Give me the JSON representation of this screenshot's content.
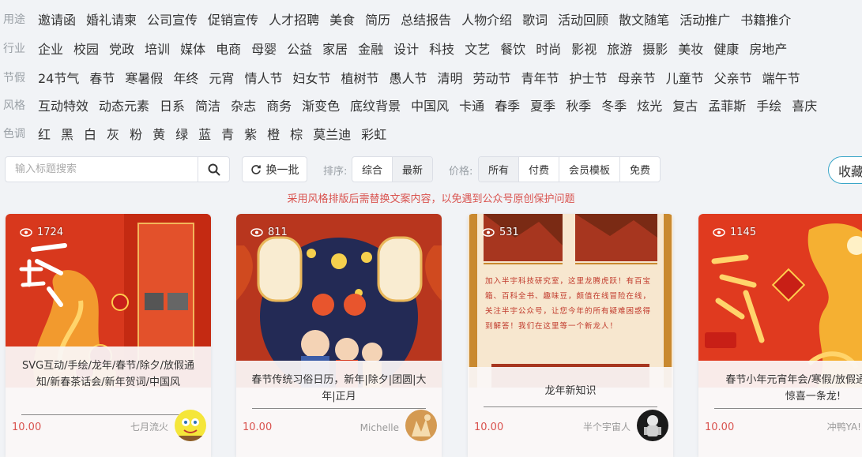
{
  "filters": [
    {
      "label": "用途",
      "items": [
        "邀请函",
        "婚礼请柬",
        "公司宣传",
        "促销宣传",
        "人才招聘",
        "美食",
        "简历",
        "总结报告",
        "人物介绍",
        "歌词",
        "活动回顾",
        "散文随笔",
        "活动推广",
        "书籍推介"
      ]
    },
    {
      "label": "行业",
      "items": [
        "企业",
        "校园",
        "党政",
        "培训",
        "媒体",
        "电商",
        "母婴",
        "公益",
        "家居",
        "金融",
        "设计",
        "科技",
        "文艺",
        "餐饮",
        "时尚",
        "影视",
        "旅游",
        "摄影",
        "美妆",
        "健康",
        "房地产"
      ]
    },
    {
      "label": "节假",
      "items": [
        "24节气",
        "春节",
        "寒暑假",
        "年终",
        "元宵",
        "情人节",
        "妇女节",
        "植树节",
        "愚人节",
        "清明",
        "劳动节",
        "青年节",
        "护士节",
        "母亲节",
        "儿童节",
        "父亲节",
        "端午节"
      ]
    },
    {
      "label": "风格",
      "items": [
        "互动特效",
        "动态元素",
        "日系",
        "简洁",
        "杂志",
        "商务",
        "渐变色",
        "底纹背景",
        "中国风",
        "卡通",
        "春季",
        "夏季",
        "秋季",
        "冬季",
        "炫光",
        "复古",
        "孟菲斯",
        "手绘",
        "喜庆"
      ]
    },
    {
      "label": "色调",
      "items": [
        "红",
        "黑",
        "白",
        "灰",
        "粉",
        "黄",
        "绿",
        "蓝",
        "青",
        "紫",
        "橙",
        "棕",
        "莫兰迪",
        "彩虹"
      ]
    }
  ],
  "toolbar": {
    "search_placeholder": "输入标题搜索",
    "refresh_label": "换一批",
    "sort_label": "排序:",
    "sort_options": [
      "综合",
      "最新"
    ],
    "price_label": "价格:",
    "price_options": [
      "所有",
      "付费",
      "会员模板",
      "免费"
    ],
    "collect_label": "收藏"
  },
  "notice": "采用风格排版后需替换文案内容，以免遇到公众号原创保护问题",
  "cards": [
    {
      "views": "1724",
      "title": "SVG互动/手绘/龙年/春节/除夕/放假通知/新春茶话会/新年贺词/中国风",
      "price": "10.00",
      "author": "七月流火"
    },
    {
      "views": "811",
      "title": "春节传统习俗日历，新年|除夕|团圆|大年|正月",
      "price": "10.00",
      "author": "Michelle"
    },
    {
      "views": "531",
      "title": "龙年新知识",
      "price": "10.00",
      "author": "半个宇宙人",
      "body_text": "加入半宇科技研究室，这里龙腾虎跃！有百宝箱、百科全书、趣味豆，颇值在线冒险在线，关注半宇公众号，让您今年的所有疑难困惑得到解答！我们在这里等一个新龙人！"
    },
    {
      "views": "1145",
      "title": "春节小年元宵年会/寒假/放假通知|龙年惊喜一条龙!",
      "price": "10.00",
      "author": "冲鸭YA!"
    }
  ],
  "colors": {
    "price": "#d9534f",
    "notice": "#d9534f",
    "accent": "#3aa6c8"
  }
}
